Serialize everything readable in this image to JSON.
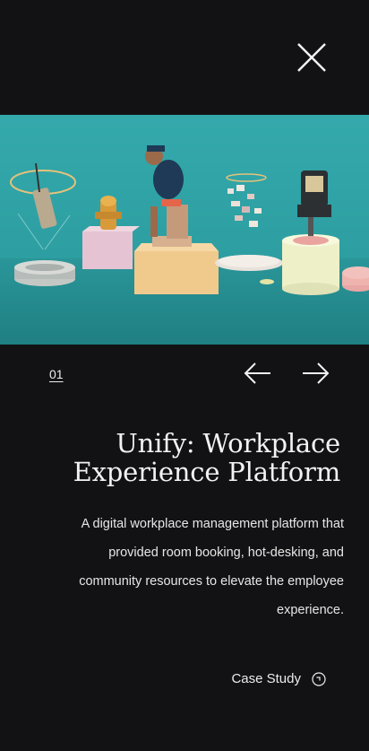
{
  "project": {
    "index": "01",
    "title_line1": "Unify: Workplace",
    "title_line2": "Experience Platform",
    "description": "A digital workplace management platform that provided room booking, hot-desking, and community resources to elevate the employee experience.",
    "cta_label": "Case Study"
  },
  "icons": {
    "close": "close-icon",
    "prev": "arrow-left-icon",
    "next": "arrow-right-icon",
    "cta": "arrow-circle-icon"
  },
  "colors": {
    "background": "#121214",
    "hero_teal": "#2fa3a6",
    "text": "#ececec"
  }
}
